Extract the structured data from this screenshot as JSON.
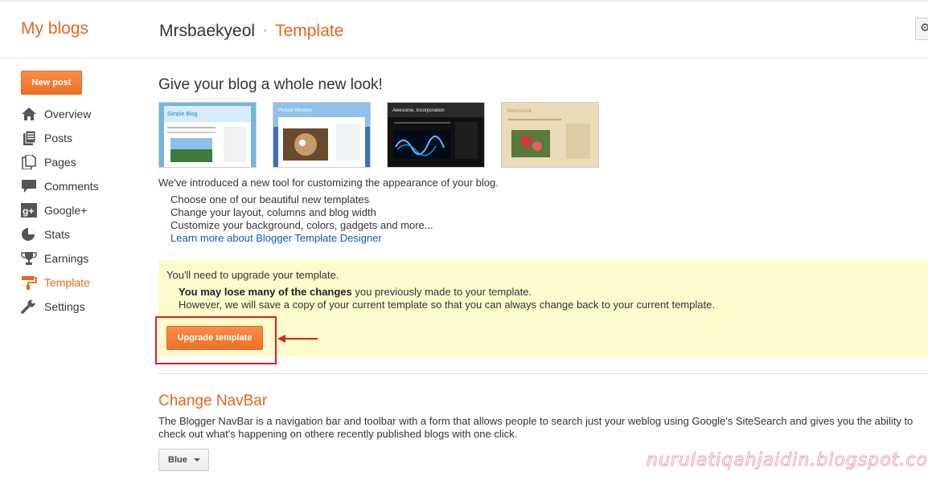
{
  "header": {
    "my_blogs": "My blogs",
    "blog_name": "Mrsbaekyeol",
    "separator": "·",
    "section": "Template"
  },
  "sidebar": {
    "new_post": "New post",
    "items": [
      {
        "label": "Overview",
        "icon": "home-icon"
      },
      {
        "label": "Posts",
        "icon": "posts-icon"
      },
      {
        "label": "Pages",
        "icon": "pages-icon"
      },
      {
        "label": "Comments",
        "icon": "comment-icon"
      },
      {
        "label": "Google+",
        "icon": "google-plus-icon"
      },
      {
        "label": "Stats",
        "icon": "stats-icon"
      },
      {
        "label": "Earnings",
        "icon": "trophy-icon"
      },
      {
        "label": "Template",
        "icon": "paint-roller-icon",
        "active": true
      },
      {
        "label": "Settings",
        "icon": "wrench-icon"
      }
    ]
  },
  "main": {
    "heading": "Give your blog a whole new look!",
    "thumbnails": [
      {
        "title": "Simple Blog"
      },
      {
        "title": "Picture Window"
      },
      {
        "title": "Awesome, Incorporation"
      },
      {
        "title": "Watermark"
      }
    ],
    "intro": "We've introduced a new tool for customizing the appearance of your blog.",
    "bullets": [
      "Choose one of our beautiful new templates",
      "Change your layout, columns and blog width",
      "Customize your background, colors, gadgets and more..."
    ],
    "learn_more": "Learn more about Blogger Template Designer"
  },
  "upgrade": {
    "notice": "You'll need to upgrade your template.",
    "warning_bold": "You may lose many of the changes",
    "warning_rest": " you previously made to your template.",
    "reassure": "However, we will save a copy of your current template so that you can always change back to your current template.",
    "button": "Upgrade template"
  },
  "navbar_section": {
    "heading": "Change NavBar",
    "description": "The Blogger NavBar is a navigation bar and toolbar with a form that allows people to search just your weblog using Google's SiteSearch and gives you the ability to check out what's happening on othere recently published blogs with one click.",
    "selected": "Blue"
  },
  "watermark": "nurulatiqahjaidin.blogspot.com",
  "colors": {
    "accent": "#e8651b",
    "link": "#1155cc",
    "warn_bg": "#fffbcc",
    "highlight": "#e0201e"
  }
}
